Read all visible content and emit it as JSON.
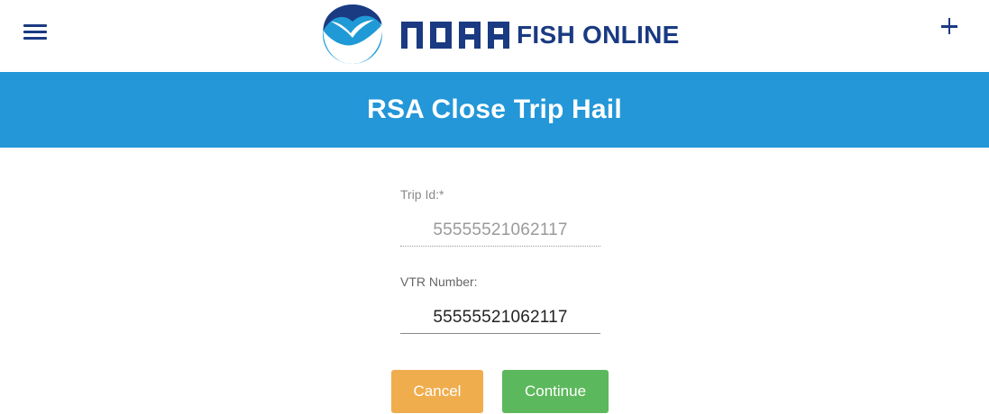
{
  "header": {
    "menu_icon": "hamburger-menu-icon",
    "logo_icon": "noaa-seagull-logo-icon",
    "brand_noaa": "NOAA",
    "brand_suffix": "FISH ONLINE",
    "add_icon": "plus-icon",
    "brand_color": "#1a3a82"
  },
  "title_bar": {
    "title": "RSA Close Trip Hail",
    "background_color": "#2397d8"
  },
  "form": {
    "trip_id": {
      "label": "Trip Id:",
      "required_marker": "*",
      "value": "55555521062117",
      "disabled": true
    },
    "vtr_number": {
      "label": "VTR Number:",
      "value": "55555521062117"
    }
  },
  "buttons": {
    "cancel_label": "Cancel",
    "cancel_color": "#f0ad4e",
    "continue_label": "Continue",
    "continue_color": "#5cb85c"
  }
}
